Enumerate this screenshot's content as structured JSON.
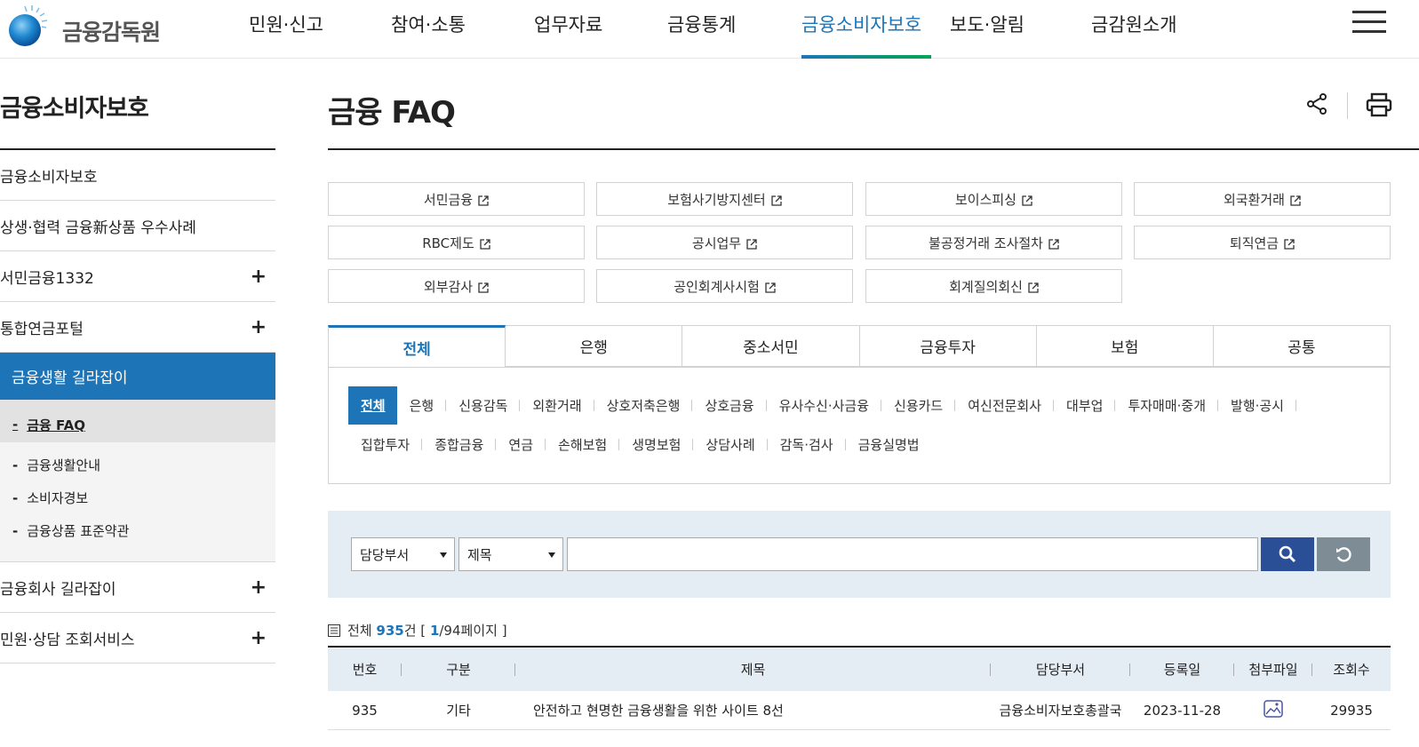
{
  "brand": {
    "name": "금융감독원"
  },
  "gnb": [
    {
      "label": "민원·신고"
    },
    {
      "label": "참여·소통"
    },
    {
      "label": "업무자료"
    },
    {
      "label": "금융통계"
    },
    {
      "label": "금융소비자보호"
    },
    {
      "label": "보도·알림"
    },
    {
      "label": "금감원소개"
    }
  ],
  "lnb": {
    "title": "금융소비자보호",
    "items": [
      {
        "label": "금융소비자보호"
      },
      {
        "label": "상생·협력 금융新상품 우수사례"
      },
      {
        "label": "서민금융1332",
        "plus": "+"
      },
      {
        "label": "통합연금포털",
        "plus": "+"
      }
    ],
    "active": "금융생활 길라잡이",
    "sub": [
      {
        "label": "금융 FAQ"
      },
      {
        "label": "금융생활안내"
      },
      {
        "label": "소비자경보"
      },
      {
        "label": "금융상품 표준약관"
      }
    ],
    "after": [
      {
        "label": "금융회사 길라잡이",
        "plus": "+"
      },
      {
        "label": "민원·상담 조회서비스",
        "plus": "+"
      }
    ],
    "dash": "-"
  },
  "page": {
    "title": "금융 FAQ"
  },
  "links": [
    {
      "label": "서민금융"
    },
    {
      "label": "보험사기방지센터"
    },
    {
      "label": "보이스피싱"
    },
    {
      "label": "외국환거래"
    },
    {
      "label": "RBC제도"
    },
    {
      "label": "공시업무"
    },
    {
      "label": "불공정거래 조사절차"
    },
    {
      "label": "퇴직연금"
    },
    {
      "label": "외부감사"
    },
    {
      "label": "공인회계사시험"
    },
    {
      "label": "회계질의회신"
    }
  ],
  "tabs": [
    {
      "label": "전체"
    },
    {
      "label": "은행"
    },
    {
      "label": "중소서민"
    },
    {
      "label": "금융투자"
    },
    {
      "label": "보험"
    },
    {
      "label": "공통"
    }
  ],
  "categories_row1": [
    {
      "label": "전체"
    },
    {
      "label": "은행"
    },
    {
      "label": "신용감독"
    },
    {
      "label": "외환거래"
    },
    {
      "label": "상호저축은행"
    },
    {
      "label": "상호금융"
    },
    {
      "label": "유사수신·사금융"
    },
    {
      "label": "신용카드"
    },
    {
      "label": "여신전문회사"
    },
    {
      "label": "대부업"
    },
    {
      "label": "투자매매·중개"
    },
    {
      "label": "발행·공시"
    }
  ],
  "categories_row2": [
    {
      "label": "집합투자"
    },
    {
      "label": "종합금융"
    },
    {
      "label": "연금"
    },
    {
      "label": "손해보험"
    },
    {
      "label": "생명보험"
    },
    {
      "label": "상담사례"
    },
    {
      "label": "감독·검사"
    },
    {
      "label": "금융실명법"
    }
  ],
  "search": {
    "select1": "담당부서",
    "select2": "제목",
    "input_value": ""
  },
  "count": {
    "prefix": "전체",
    "total": "935",
    "unit": "건",
    "open": "[",
    "page": "1",
    "pages": "/94페이지",
    "close": "]"
  },
  "table": {
    "headers": [
      "번호",
      "구분",
      "제목",
      "담당부서",
      "등록일",
      "첨부파일",
      "조회수"
    ],
    "rows": [
      {
        "no": "935",
        "type": "기타",
        "title": "안전하고 현명한 금융생활을 위한 사이트 8선",
        "dept": "금융소비자보호총괄국",
        "date": "2023-11-28",
        "attach": "image-file-icon",
        "views": "29935"
      }
    ]
  },
  "colors": {
    "accent": "#1d75b8",
    "search_btn": "#2b4f96",
    "reset_btn": "#7e8c96",
    "search_bg": "#e4ecf4"
  }
}
